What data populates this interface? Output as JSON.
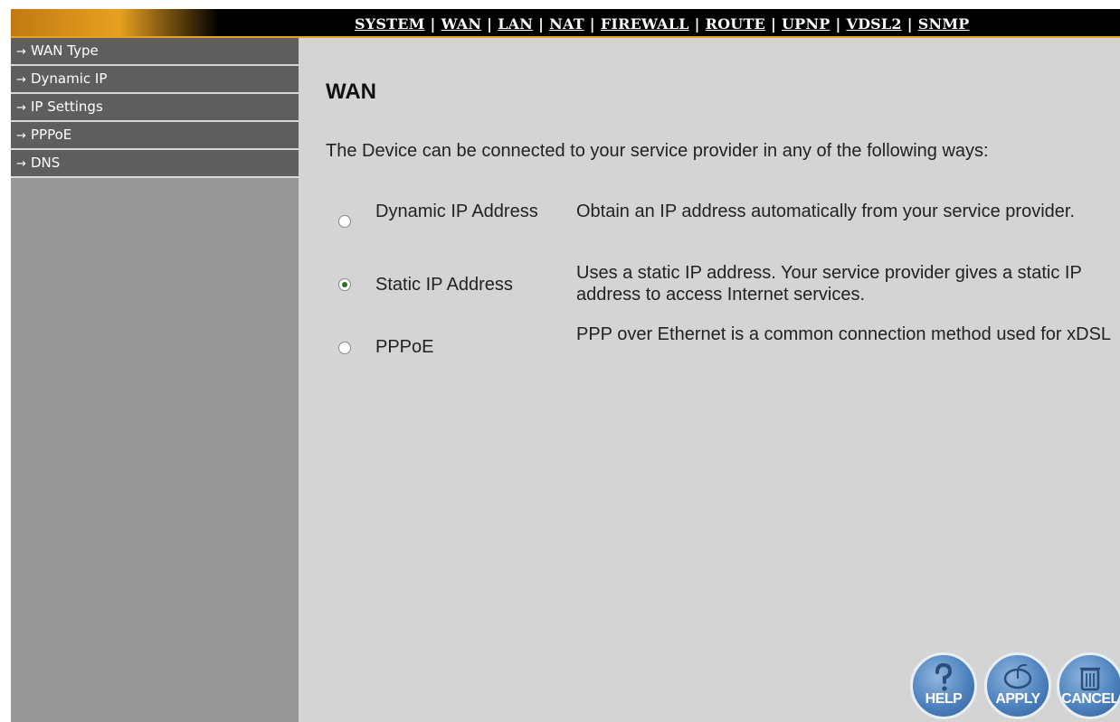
{
  "topnav": {
    "links": [
      "SYSTEM",
      "WAN",
      "LAN",
      "NAT",
      "FIREWALL",
      "ROUTE",
      "UPNP",
      "VDSL2",
      "SNMP"
    ],
    "separator": "|"
  },
  "sidebar": {
    "items": [
      {
        "label": "WAN Type"
      },
      {
        "label": "Dynamic IP"
      },
      {
        "label": "IP Settings"
      },
      {
        "label": "PPPoE"
      },
      {
        "label": "DNS"
      }
    ],
    "arrow": "→"
  },
  "main": {
    "title": "WAN",
    "intro": "The Device can be connected to your service provider in any of the following ways:",
    "options": [
      {
        "label": "Dynamic IP Address",
        "description": "Obtain an IP address automatically from your service provider.",
        "selected": false
      },
      {
        "label": "Static IP Address",
        "description": "Uses a static IP address. Your service provider gives a static IP address to access Internet services.",
        "selected": true
      },
      {
        "label": "PPPoE",
        "description": "PPP over Ethernet is a common connection method used for xDSL",
        "selected": false
      }
    ]
  },
  "buttons": {
    "help": {
      "label": "HELP",
      "icon": "question-icon"
    },
    "apply": {
      "label": "APPLY",
      "icon": "mouse-icon"
    },
    "cancel": {
      "label": "CANCEL",
      "icon": "trash-icon"
    }
  },
  "colors": {
    "topbar_bg": "#000000",
    "topbar_accent": "#e8a020",
    "sidebar_bg": "#979797",
    "sidebar_item_bg": "#5e5e5e",
    "main_bg": "#d4d4d4",
    "button_blue": "#4f83bf"
  }
}
